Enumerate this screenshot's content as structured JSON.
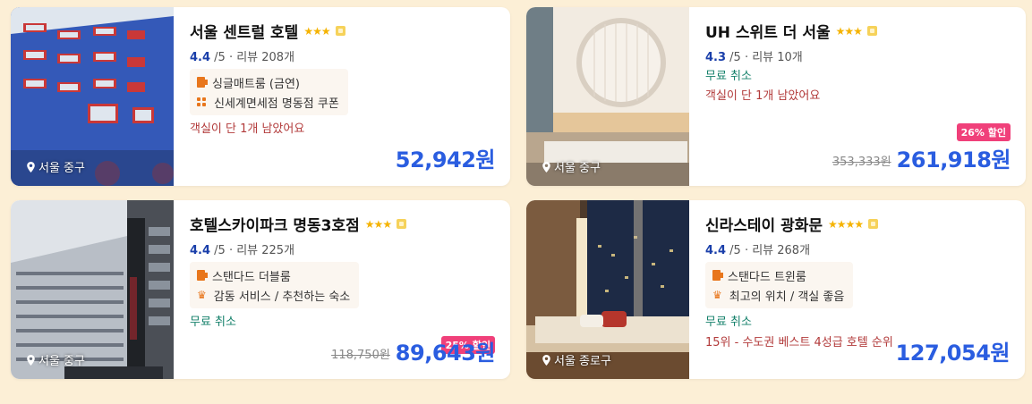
{
  "hotels": [
    {
      "name": "서울 센트럴 호텔",
      "stars": "★★★",
      "score": "4.4",
      "rating_suffix": " /5 · 리뷰 208개",
      "features": [
        "싱글매트룸 (금연)",
        "신세계면세점 명동점 쿠폰"
      ],
      "note_red": "객실이 단 1개 남았어요",
      "location": "서울 중구",
      "price": "52,942원"
    },
    {
      "name": "UH 스위트 더 서울",
      "stars": "★★★",
      "score": "4.3",
      "rating_suffix": " /5 · 리뷰 10개",
      "note_green": "무료 취소",
      "note_red": "객실이 단 1개 남았어요",
      "location": "서울 중구",
      "discount": "26% 할인",
      "old_price": "353,333원",
      "price": "261,918원"
    },
    {
      "name": "호텔스카이파크 명동3호점",
      "stars": "★★★",
      "score": "4.4",
      "rating_suffix": " /5 · 리뷰 225개",
      "features": [
        "스탠다드 더블룸",
        "감동 서비스 / 추천하는 숙소"
      ],
      "note_green": "무료 취소",
      "location": "서울 중구",
      "discount": "25% 할인",
      "old_price": "118,750원",
      "price": "89,643원"
    },
    {
      "name": "신라스테이 광화문",
      "stars": "★★★★",
      "score": "4.4",
      "rating_suffix": " /5 · 리뷰 268개",
      "features": [
        "스탠다드 트윈룸",
        "최고의 위치 / 객실 좋음"
      ],
      "note_green": "무료 취소",
      "note_red": "15위 - 수도권 베스트 4성급 호텔 순위",
      "location": "서울 종로구",
      "price": "127,054원"
    }
  ],
  "icons": {
    "room": "bed-icon",
    "coupon": "grid-icon",
    "crown": "crown-icon",
    "location": "pin-icon",
    "badge": "hotel-badge-icon"
  },
  "colors": {
    "price": "#2a5de0",
    "score": "#1a3faa",
    "discount": "#f0407a",
    "green": "#14806a",
    "red": "#b23a3a",
    "accent_orange": "#e8761c",
    "background": "#fcefd6"
  }
}
